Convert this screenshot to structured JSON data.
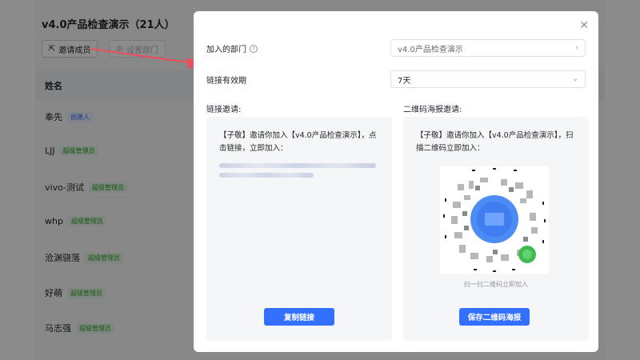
{
  "background": {
    "title": "v4.0产品检查演示（21人）",
    "buttons": [
      "邀请成员",
      "设置部门"
    ],
    "table_header": "姓名",
    "members": [
      {
        "name": "奉先",
        "role": "创建人",
        "kind": "creator"
      },
      {
        "name": "LJJ",
        "role": "超级管理员",
        "kind": "admin"
      },
      {
        "name": "vivo-测试",
        "role": "超级管理员",
        "kind": "admin"
      },
      {
        "name": "whp",
        "role": "超级管理员",
        "kind": "admin"
      },
      {
        "name": "沧渊骁落",
        "role": "超级管理员",
        "kind": "admin"
      },
      {
        "name": "好萌",
        "role": "超级管理员",
        "kind": "admin"
      },
      {
        "name": "马志强",
        "role": "超级管理员",
        "kind": "admin"
      }
    ]
  },
  "modal": {
    "close_icon": "close-icon",
    "department_label": "加入的部门",
    "department_value": "v4.0产品检查演示",
    "validity_label": "链接有效期",
    "validity_value": "7天",
    "link_section_title": "链接邀请:",
    "link_invite_text": "【子敬】邀请你加入【v4.0产品检查演示】，点击链接，立即加入：",
    "copy_link_button": "复制链接",
    "qr_section_title": "二维码海报邀请:",
    "qr_invite_text": "【子敬】邀请你加入【v4.0产品检查演示】，扫描二维码立即加入：",
    "qr_caption": "扫一扫二维码立即加入",
    "save_qr_button": "保存二维码海报"
  },
  "colors": {
    "primary": "#3370ff",
    "arrow": "#e8505b",
    "overlay": "rgba(0,0,0,0.45)"
  }
}
